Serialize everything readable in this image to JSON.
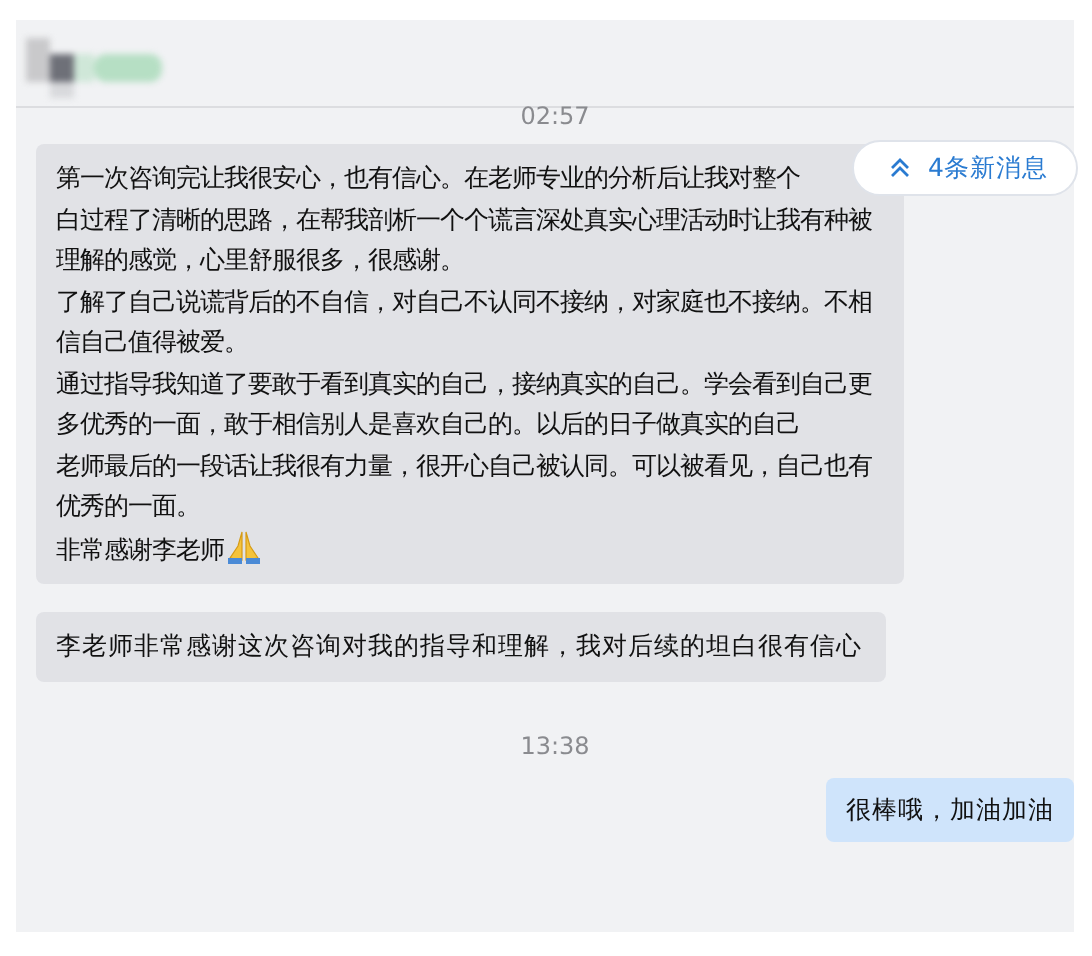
{
  "header": {
    "kind": "blurred"
  },
  "new_messages": {
    "label": "4条新消息"
  },
  "messages": [
    {
      "kind": "time",
      "text": "02:57"
    },
    {
      "kind": "incoming",
      "paragraphs": [
        "第一次咨询完让我很安心，也有信心。在老师专业的分析后让我对整个白过程了清晰的思路，在帮我剖析一个个谎言深处真实心理活动时让我有种被理解的感觉，心里舒服很多，很感谢。",
        "了解了自己说谎背后的不自信，对自己不认同不接纳，对家庭也不接纳。不相信自己值得被爱。",
        "通过指导我知道了要敢于看到真实的自己，接纳真实的自己。学会看到自己更多优秀的一面，敢于相信别人是喜欢自己的。以后的日子做真实的自己",
        "老师最后的一段话让我很有力量，很开心自己被认同。可以被看见，自己也有优秀的一面。",
        "非常感谢李老师"
      ],
      "emoji": true
    },
    {
      "kind": "incoming",
      "paragraphs": [
        "李老师非常感谢这次咨询对我的指导和理解，我对后续的坦白很有信心"
      ]
    },
    {
      "kind": "time",
      "text": "13:38"
    },
    {
      "kind": "outgoing",
      "paragraphs": [
        "很棒哦，加油加油"
      ]
    }
  ]
}
